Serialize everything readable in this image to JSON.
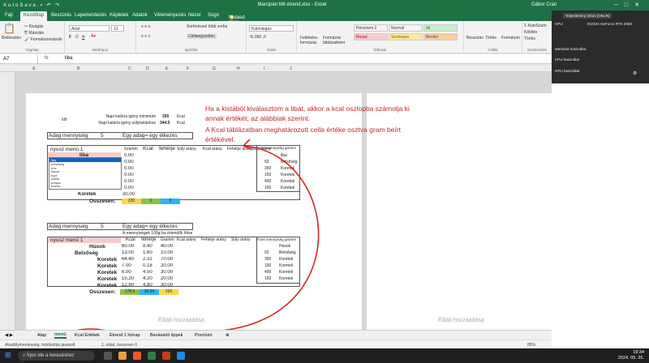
{
  "window": {
    "title": "Marcipán Mit étrend.xlsx  -  Excel",
    "user": "Gábor Cran",
    "qat": "AutoSave ▪ ↶ ↷"
  },
  "ribbon_tabs": [
    "Fájl",
    "Kezdőlap",
    "Beszúrás",
    "Lapelrendezés",
    "Képletek",
    "Adatok",
    "Véleményezés",
    "Nézet",
    "Súgó"
  ],
  "tell_me": "Mutasd meg, hogyan csináljam",
  "ribbon": {
    "clipboard": {
      "label": "Vágólap",
      "paste": "Beillesztés",
      "cut": "Kivágás",
      "copy": "Másolás",
      "painter": "Formátummásoló"
    },
    "font": {
      "label": "Betűtípus",
      "family": "Arial",
      "size": "12"
    },
    "alignment": {
      "label": "Igazítás",
      "wrap": "Sortöréssel több sorba",
      "merge": "Cellaegyesítés"
    },
    "number": {
      "label": "Szám",
      "format": "Különleges"
    },
    "styles": {
      "label": "Stílusok",
      "cond": "Feltételes formázás",
      "table": "Formázás táblázatként",
      "cells": [
        {
          "name": "Pénznem 2",
          "bg": "#ffffff",
          "color": "#333333"
        },
        {
          "name": "Normál",
          "bg": "#ffffff",
          "color": "#333333"
        },
        {
          "name": "Jó",
          "bg": "#c6efce",
          "color": "#006100"
        },
        {
          "name": "Rossz",
          "bg": "#ffc7ce",
          "color": "#9c0006"
        },
        {
          "name": "Semleges",
          "bg": "#ffeb9c",
          "color": "#9c5700"
        },
        {
          "name": "Bevitel",
          "bg": "#ffcc99",
          "color": "#3f3f76"
        }
      ]
    },
    "cells": {
      "label": "Cellák",
      "insert": "Beszúrás",
      "delete": "Törlés",
      "format": "Formátum"
    },
    "editing": {
      "label": "Szerkesztés",
      "autosum": "AutoSzum",
      "fill": "Kitöltés",
      "clear": "Törlés",
      "sort": "Rendezés és szűrés",
      "find": "Keresés és kijelölés"
    }
  },
  "formula_bar": {
    "name_box": "A7",
    "fx": "fx",
    "value": "liba"
  },
  "columns": [
    "A",
    "B",
    "C",
    "D",
    "E",
    "F",
    "G",
    "H",
    "I",
    "J"
  ],
  "sheet": {
    "top_label": "idő",
    "row1": {
      "label": "Napi kalória igény minimum",
      "value": "265",
      "unit": "Kcal"
    },
    "row2": {
      "label": "Napi kalória igény súlytartáshoz",
      "value": "344.5",
      "unit": "Kcal"
    },
    "table1": {
      "header_left": "Adag mennyiség",
      "header_num": "5",
      "header_right": "Egy adag= egy étkezés",
      "col_title": "nyusz menü 1",
      "cols": [
        "Gramm",
        "Kcal",
        "fehérje",
        "Súly arány",
        "Kcal arány",
        "Fehérje arány",
        "Súly arány"
      ],
      "selected": "liba",
      "rows": [
        [
          "0.00"
        ],
        [
          "0.00"
        ],
        [
          "0.00"
        ],
        [
          "0.00"
        ],
        [
          "0.00"
        ],
        [
          "0.00"
        ],
        [
          "30.00"
        ]
      ],
      "last_food": "Koretek",
      "total_label": "Összesen:",
      "totals": [
        "230",
        "0",
        "0"
      ]
    },
    "listbox_items": [
      "liba",
      "belsőség",
      "hús",
      "kacsa",
      "nyúl",
      "csirke",
      "pulyka",
      "marha",
      "hal"
    ],
    "ref_table": {
      "header": "Fizet mennyiség gramm",
      "rows": [
        [
          "",
          "liba"
        ],
        [
          "50",
          "Belsőség"
        ],
        [
          "350",
          "Koretek"
        ],
        [
          "150",
          "Koretek"
        ],
        [
          "400",
          "Koretek"
        ],
        [
          "150",
          "Koretek"
        ]
      ]
    },
    "table2": {
      "header_left": "Adag mennyiség",
      "header_num": "5",
      "header_right": "Egy adag= egy étkezés",
      "subheader": "A mennyiségek 100g-ba értendők fölve",
      "col_title": "nyusz menü 1",
      "cols": [
        "Kcal",
        "fehérje",
        "Gramm",
        "Kcal arány",
        "Fehérje arány",
        "Súly arány"
      ],
      "rows": [
        [
          "Húsok",
          "60.00",
          "8.40",
          "40.00"
        ],
        [
          "Belsőség",
          "13.00",
          "1.60",
          "10.00"
        ],
        [
          "Koretek",
          "64.40",
          "2.31",
          "70.00"
        ],
        [
          "Koretek",
          "7.00",
          "0.18",
          "20.00"
        ],
        [
          "Koretek",
          "6.00",
          "4.50",
          "30.00"
        ],
        [
          "Koretek",
          "15.20",
          "4.20",
          "20.00"
        ],
        [
          "Koretek",
          "12.90",
          "4.80",
          "30.00"
        ]
      ],
      "total_label": "Összesen:",
      "totals": [
        "178.5",
        "25.96",
        "220"
      ]
    },
    "ref_table2": {
      "header": "Fizet mennyiség gramm",
      "rows": [
        [
          "",
          "Húsok"
        ],
        [
          "50",
          "Belsőség"
        ],
        [
          "350",
          "Koretek"
        ],
        [
          "150",
          "Koretek"
        ],
        [
          "400",
          "Koretek"
        ],
        [
          "150",
          "Koretek"
        ]
      ]
    },
    "page_placeholder": "Éllláb hozzáadása",
    "placeholder_right": "Éllláb hozzáadása"
  },
  "annotation": {
    "line1": "Ha a kistából kiválasztom a libát, akkor a kcal oszlopba számolja ki annak értékét, az alábbiak szerint.",
    "line2": "A Kcal táblázatban meghatározott cella értéke osztva  gram beírt értékével."
  },
  "sheet_tabs": [
    "Alap",
    "menü",
    "Kcal Értékek",
    "Étrend 1 hónap",
    "Bevásárló lippek",
    "Porciózó"
  ],
  "active_tab": "menü",
  "status": {
    "left": "Akadálymentesség: módosítás javasolt",
    "mid": "1. oldal, összesen 6",
    "zoom": "85%"
  },
  "taskbar": {
    "search": "Írjon ide a kereséshez",
    "time": "19:34",
    "date": "2024. 05. 25."
  },
  "gpu_panel": {
    "header": "Teljesítmény ciklus (ON=R)",
    "gpu_label": "GPU",
    "gpu_name": "NVIDIA GeForce RTX 2080",
    "cpu": "CPU használat",
    "gpu": "GPU használat",
    "mem": "Memória használat"
  }
}
